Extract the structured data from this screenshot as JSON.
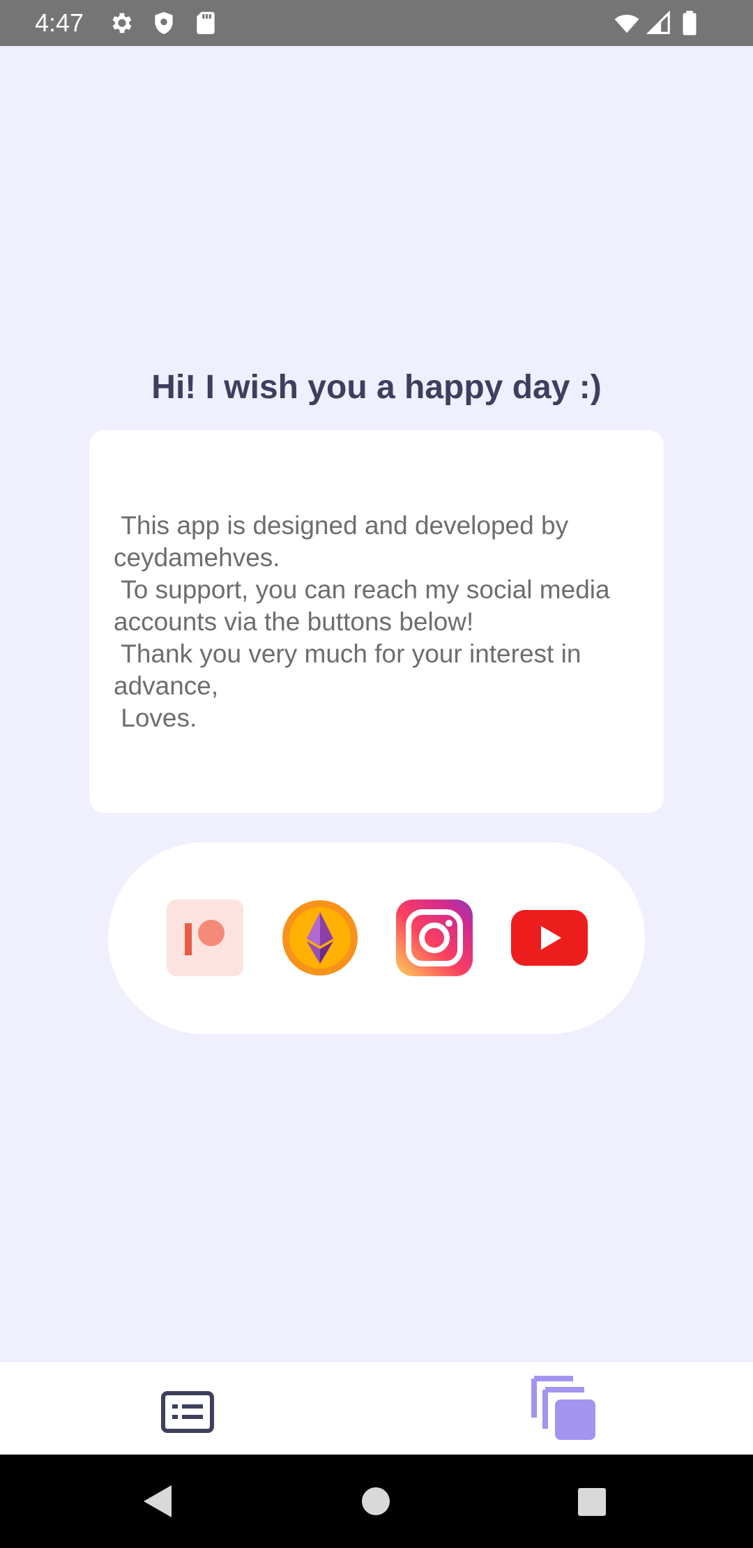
{
  "status_bar": {
    "time": "4:47",
    "icons": [
      "gear-icon",
      "shield-icon",
      "sd-card-icon",
      "wifi-icon",
      "signal-icon",
      "battery-icon"
    ]
  },
  "main": {
    "greeting": "Hi! I wish you a happy day :)",
    "message": " This app is designed and developed by ceydamehves.\n To support, you can reach my social media accounts via the buttons below!\n Thank you very much for your interest in advance,\n Loves."
  },
  "social_buttons": [
    {
      "name": "patreon",
      "icon": "patreon-icon",
      "color": "#f26b5b"
    },
    {
      "name": "ethereum",
      "icon": "ethereum-icon",
      "color": "#f7931a"
    },
    {
      "name": "instagram",
      "icon": "instagram-icon",
      "color": "#d6249f"
    },
    {
      "name": "youtube",
      "icon": "youtube-icon",
      "color": "#ff0000"
    }
  ],
  "bottom_nav": {
    "items": [
      {
        "icon": "card-list-icon",
        "selected": false
      },
      {
        "icon": "stacked-cards-icon",
        "selected": true
      }
    ],
    "accent": "#a394f0",
    "inactive": "#3e3f5e"
  },
  "system_nav": {
    "icons": [
      "back-icon",
      "home-icon",
      "recents-icon"
    ]
  }
}
